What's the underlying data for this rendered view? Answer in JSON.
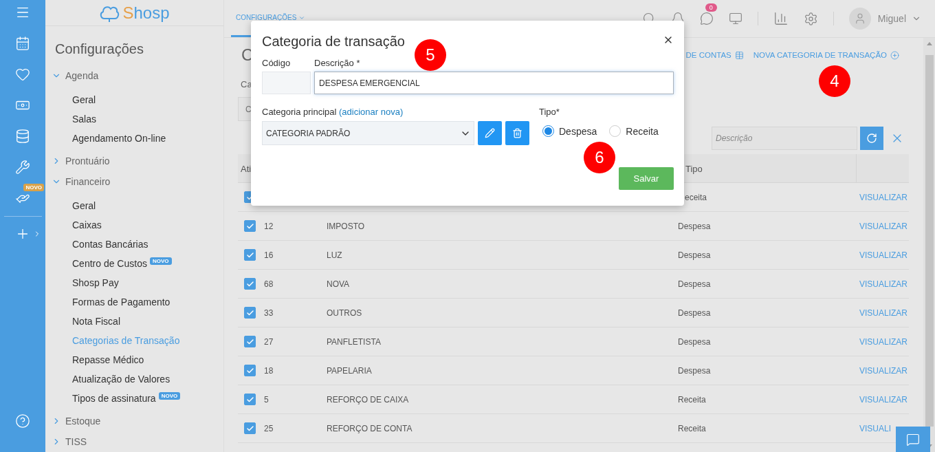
{
  "rail": {
    "items": [
      {
        "kind": "menu"
      },
      {
        "kind": "calendar"
      },
      {
        "kind": "heart"
      },
      {
        "kind": "money"
      },
      {
        "kind": "database"
      },
      {
        "kind": "tools"
      },
      {
        "kind": "hand",
        "badge": "NOVO"
      },
      {
        "kind": "add"
      }
    ]
  },
  "sidebar": {
    "logo": "Shosp",
    "title": "Configurações",
    "sections": [
      {
        "label": "Agenda",
        "expanded": true,
        "children": [
          {
            "label": "Geral",
            "selected": false
          },
          {
            "label": "Salas",
            "selected": false
          },
          {
            "label": "Agendamento On-line",
            "selected": false
          }
        ]
      },
      {
        "label": "Prontuário",
        "expanded": false
      },
      {
        "label": "Financeiro",
        "expanded": true,
        "children": [
          {
            "label": "Geral",
            "selected": false
          },
          {
            "label": "Caixas",
            "selected": false
          },
          {
            "label": "Contas Bancárias",
            "selected": false
          },
          {
            "label": "Centro de Custos",
            "selected": false,
            "badge": "NOVO"
          },
          {
            "label": "Shosp Pay",
            "selected": false
          },
          {
            "label": "Formas de Pagamento",
            "selected": false
          },
          {
            "label": "Nota Fiscal",
            "selected": false
          },
          {
            "label": "Categorias de Transação",
            "selected": true
          },
          {
            "label": "Repasse Médico",
            "selected": false
          },
          {
            "label": "Atualização de Valores",
            "selected": false
          },
          {
            "label": "Tipos de assinatura",
            "selected": false,
            "badge": "NOVO"
          }
        ]
      },
      {
        "label": "Estoque",
        "expanded": false
      },
      {
        "label": "TISS",
        "expanded": false
      }
    ]
  },
  "topbar": {
    "tabs": [
      {
        "label": "CONFIGURAÇÕES",
        "selected": true
      }
    ],
    "notification_count": "0",
    "user": "Miguel"
  },
  "page": {
    "title": "C",
    "filter_label": "Ca",
    "filter_value": "C",
    "links": [
      {
        "label": "DE CONTAS",
        "kind": "grid"
      },
      {
        "label": "NOVA CATEGORIA DE TRANSAÇÃO",
        "kind": "add"
      }
    ],
    "search": {
      "placeholder": "Descrição"
    }
  },
  "table": {
    "columns": {
      "active": "Ati",
      "type": "Tipo"
    },
    "rows": [
      {
        "checked": true,
        "type": "eceita",
        "action": "VISUALIZAR"
      },
      {
        "checked": true,
        "code": "12",
        "description": "IMPOSTO",
        "type": "Despesa",
        "action": "VISUALIZAR"
      },
      {
        "checked": true,
        "code": "16",
        "description": "LUZ",
        "type": "Despesa",
        "action": "VISUALIZAR"
      },
      {
        "checked": true,
        "code": "68",
        "description": "NOVA",
        "type": "Despesa",
        "action": "VISUALIZAR"
      },
      {
        "checked": true,
        "code": "33",
        "description": "OUTROS",
        "type": "Despesa",
        "action": "VISUALIZAR"
      },
      {
        "checked": true,
        "code": "27",
        "description": "PANFLETISTA",
        "type": "Despesa",
        "action": "VISUALIZAR"
      },
      {
        "checked": true,
        "code": "18",
        "description": "PAPELARIA",
        "type": "Despesa",
        "action": "VISUALIZAR"
      },
      {
        "checked": true,
        "code": "5",
        "description": "REFORÇO DE CAIXA",
        "type": "Receita",
        "action": "VISUALIZAR"
      },
      {
        "checked": true,
        "code": "25",
        "description": "REFORÇO DE CONTA",
        "type": "Receita",
        "action": "VISUALI"
      }
    ]
  },
  "modal": {
    "title": "Categoria de transação",
    "code_label": "Código",
    "description_label": "Descrição *",
    "description_value": "DESPESA EMERGENCIAL",
    "parent_label": "Categoria principal",
    "parent_link": "(adicionar nova)",
    "parent_value": "CATEGORIA PADRÃO",
    "type_label": "Tipo*",
    "type_options": [
      {
        "label": "Despesa",
        "selected": true
      },
      {
        "label": "Receita",
        "selected": false
      }
    ],
    "save": "Salvar"
  },
  "annotations": [
    {
      "label": "5"
    },
    {
      "label": "4"
    },
    {
      "label": "6"
    }
  ]
}
